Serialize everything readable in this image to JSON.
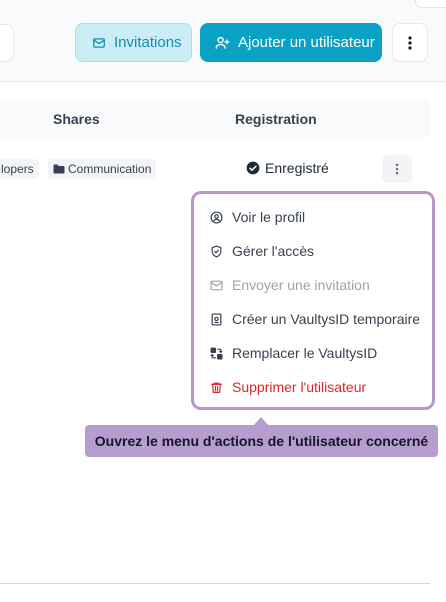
{
  "toolbar": {
    "invitations_label": "Invitations",
    "add_user_label": "Ajouter un utilisateur"
  },
  "table": {
    "headers": {
      "shares": "Shares",
      "registration": "Registration"
    },
    "row": {
      "share_chips": [
        "lopers",
        "Communication"
      ],
      "registration_status": "Enregistré"
    }
  },
  "action_menu": {
    "items": [
      {
        "label": "Voir le profil",
        "icon": "user-circle-icon",
        "state": "normal"
      },
      {
        "label": "Gérer l'accès",
        "icon": "shield-icon",
        "state": "normal"
      },
      {
        "label": "Envoyer une invitation",
        "icon": "mail-icon",
        "state": "disabled"
      },
      {
        "label": "Créer un VaultysID temporaire",
        "icon": "id-card-icon",
        "state": "normal"
      },
      {
        "label": "Remplacer le VaultysID",
        "icon": "swap-icon",
        "state": "normal"
      },
      {
        "label": "Supprimer l'utilisateur",
        "icon": "trash-icon",
        "state": "danger"
      }
    ]
  },
  "tooltip": {
    "text": "Ouvrez le menu d'actions de l'utilisateur concerné"
  },
  "colors": {
    "accent": "#0aa2c4",
    "accent_light": "#cbeef6",
    "highlight": "#b896cc",
    "danger": "#dc2626"
  }
}
